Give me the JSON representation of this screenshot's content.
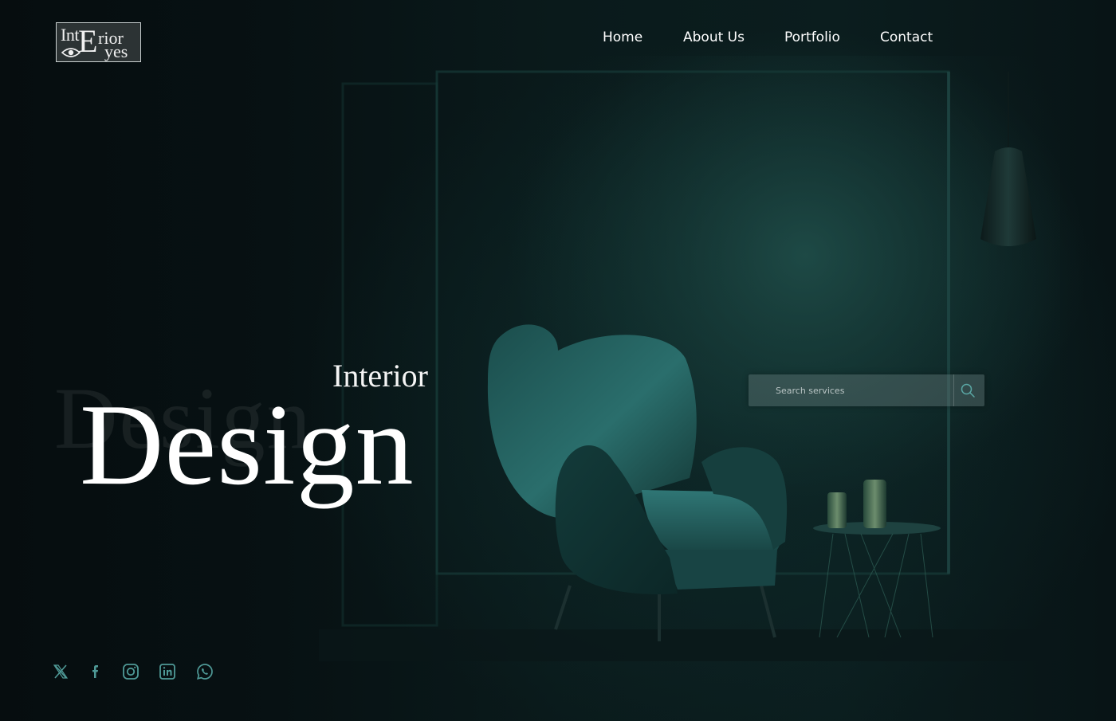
{
  "brand": {
    "logo_parts": [
      "Int",
      "E",
      "rior",
      "yes"
    ]
  },
  "nav": {
    "items": [
      {
        "label": "Home"
      },
      {
        "label": "About Us"
      },
      {
        "label": "Portfolio"
      },
      {
        "label": "Contact"
      }
    ]
  },
  "hero": {
    "subtitle": "Interior",
    "title": "Design",
    "title_shadow": "Design"
  },
  "search": {
    "placeholder": "Search services",
    "icon": "search-icon"
  },
  "social": {
    "icons": [
      "x-icon",
      "facebook-icon",
      "instagram-icon",
      "linkedin-icon",
      "whatsapp-icon"
    ]
  },
  "colors": {
    "background": "#071012",
    "accent_teal": "#2f6e6a",
    "icon_teal": "#4f9a97",
    "text": "#ffffff"
  }
}
